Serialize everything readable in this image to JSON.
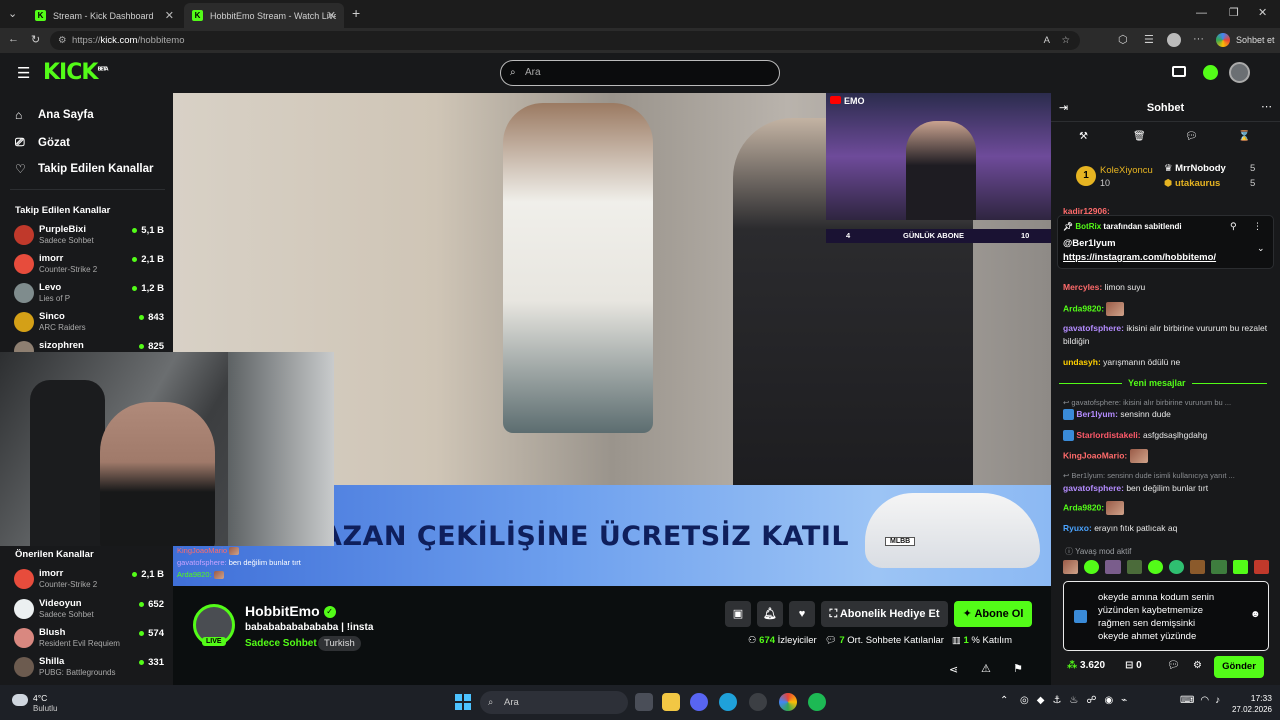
{
  "browser": {
    "tabs": [
      {
        "title": "Stream - Kick Dashboard"
      },
      {
        "title": "HobbitEmo Stream - Watch Live o"
      }
    ],
    "url_prefix": "https://",
    "url_host": "kick.com",
    "url_path": "/hobbitemo",
    "profile_label": "Sohbet et"
  },
  "header": {
    "logo": "KICK",
    "logo_badge": "BETA",
    "search_placeholder": "Ara"
  },
  "nav": {
    "items": [
      {
        "label": "Ana Sayfa",
        "icon": "home-icon"
      },
      {
        "label": "Gözat",
        "icon": "browse-icon"
      },
      {
        "label": "Takip Edilen Kanallar",
        "icon": "heart-icon"
      }
    ]
  },
  "followed": {
    "title": "Takip Edilen Kanallar",
    "channels": [
      {
        "name": "PurpleBixi",
        "game": "Sadece Sohbet",
        "viewers": "5,1 B",
        "color": "#c0392b"
      },
      {
        "name": "imorr",
        "game": "Counter-Strike 2",
        "viewers": "2,1 B",
        "color": "#e74c3c"
      },
      {
        "name": "Levo",
        "game": "Lies of P",
        "viewers": "1,2 B",
        "color": "#7f8c8d"
      },
      {
        "name": "Sinco",
        "game": "ARC Raiders",
        "viewers": "843",
        "color": "#d4a017"
      },
      {
        "name": "sizophren",
        "game": "",
        "viewers": "825",
        "color": "#8e7f71"
      }
    ]
  },
  "suggested": {
    "title": "Önerilen Kanallar",
    "channels": [
      {
        "name": "imorr",
        "game": "Counter-Strike 2",
        "viewers": "2,1 B",
        "color": "#e74c3c"
      },
      {
        "name": "Videoyun",
        "game": "Sadece Sohbet",
        "viewers": "652",
        "color": "#ecf0f1"
      },
      {
        "name": "Blush",
        "game": "Resident Evil Requiem",
        "viewers": "574",
        "color": "#d98880"
      },
      {
        "name": "Shilla",
        "game": "PUBG: Battlegrounds",
        "viewers": "331",
        "color": "#6c5b4f"
      }
    ]
  },
  "video": {
    "cam_label": "EMO",
    "sub_left": "4",
    "sub_label": "GÜNLÜK ABONE",
    "sub_right": "10",
    "banner_text": "RAMAZAN ÇEKİLİŞİNE ÜCRETSİZ KATIL",
    "banner_car_plate": "MLBB",
    "overlay_chat": [
      {
        "user": "KingJoaoMario",
        "msg": ""
      },
      {
        "user": "gavatofsphere:",
        "msg": "ben değilim bunlar tırt"
      },
      {
        "user": "Arda9820:",
        "msg": ""
      }
    ]
  },
  "stream": {
    "streamer": "HobbitEmo",
    "live": "LIVE",
    "title": "babababababababa | !insta",
    "category": "Sadece Sohbet",
    "tag": "Turkish",
    "gift_label": "Abonelik Hediye Et",
    "subscribe_label": "Abone Ol",
    "viewers": "674",
    "viewers_label": "İzleyiciler",
    "chatters": "7",
    "chatters_label": "Ort. Sohbete Katılanlar",
    "participation": "1",
    "participation_label": "% Katılım"
  },
  "chat": {
    "title": "Sohbet",
    "leaders": [
      {
        "rank": "1",
        "name": "KoleXiyoncu",
        "score": "10"
      },
      {
        "name": "MrrNobody",
        "score": "5"
      },
      {
        "name": "utakaurus",
        "score": "5"
      }
    ],
    "pinned_by": "BotRix",
    "pinned_suffix": "tarafından sabitlendi",
    "pinned_user": "@Ber1lyum",
    "pinned_link": "https://instagram.com/hobbitemo/",
    "partial_top": "kadir12906:",
    "messages_before": [
      {
        "user": "Mercyles:",
        "color": "#ff6b6b",
        "msg": "limon suyu"
      },
      {
        "user": "Arda9820:",
        "color": "#53fc18",
        "msg": "",
        "emote": true
      },
      {
        "user": "gavatofsphere:",
        "color": "#b48cff",
        "msg": "ikisini alır birbirine vururum bu rezalet bildiğin"
      },
      {
        "user": "undasyh:",
        "color": "#ffd000",
        "msg": "yarışmanın ödülü ne"
      }
    ],
    "new_label": "Yeni mesajlar",
    "messages_after": [
      {
        "reply": "gavatofsphere: ikisini alır birbirine vururum bu ..."
      },
      {
        "user": "Ber1lyum:",
        "color": "#b48cff",
        "msg": "sensinn dude",
        "badge": true
      },
      {
        "user": "Starlordistakeli:",
        "color": "#ff5a6a",
        "msg": "asfgdsaşlhgdahg",
        "badge": true
      },
      {
        "user": "KingJoaoMario:",
        "color": "#ff6b6b",
        "msg": "",
        "emote": true
      },
      {
        "reply": "Ber1lyum: sensinn dude isimli kullanıcıya yanıt ..."
      },
      {
        "user": "gavatofsphere:",
        "color": "#b48cff",
        "msg": "ben değilim bunlar tırt"
      },
      {
        "user": "Arda9820:",
        "color": "#53fc18",
        "msg": "",
        "emote": true
      },
      {
        "user": "Ryuxo:",
        "color": "#4aa3ff",
        "msg": "erayın fıtık patlıcak aq"
      }
    ],
    "slow_mode": "Yavaş mod aktif",
    "input_text": "okeyde amına kodum senin yüzünden kaybetmemize rağmen sen demişsinki okeyde ahmet yüzünde",
    "points": "3.620",
    "box_count": "0",
    "send_label": "Gönder"
  },
  "taskbar": {
    "weather_temp": "4°C",
    "weather_text": "Bulutlu",
    "search_label": "Ara",
    "time": "17:33",
    "date": "27.02.2026"
  }
}
